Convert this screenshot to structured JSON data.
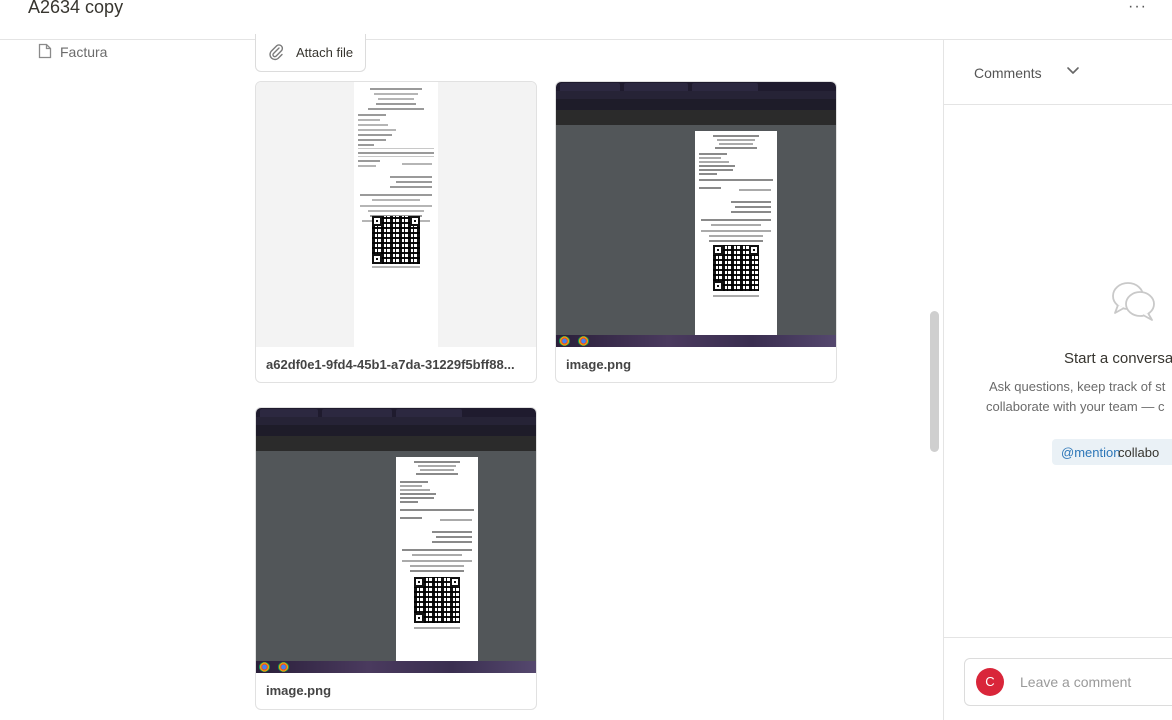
{
  "header": {
    "title": "A2634 copy",
    "more_icon": "ellipsis-icon",
    "more_label": "···"
  },
  "property": {
    "icon": "document-icon",
    "label": "Factura"
  },
  "attach": {
    "icon": "paperclip-icon",
    "label": "Attach file"
  },
  "attachments": [
    {
      "name": "a62df0e1-9fd4-45b1-a7da-31229f5bff88...",
      "kind": "receipt"
    },
    {
      "name": "image.png",
      "kind": "browser-screenshot"
    },
    {
      "name": "image.png",
      "kind": "browser-screenshot"
    }
  ],
  "comments": {
    "title": "Comments",
    "chevron_icon": "chevron-down-icon",
    "empty_icon": "chat-bubbles-icon",
    "empty_title": "Start a conversa",
    "empty_desc_line1": "Ask questions, keep track of st",
    "empty_desc_line2": "collaborate with your team — c",
    "mention": "@mention",
    "mention_rest": "collabo",
    "avatar_initial": "C",
    "composer_placeholder": "Leave a comment"
  },
  "colors": {
    "avatar": "#d9263a",
    "mention_bg": "#eaf1f6",
    "mention_text": "#2e77b8"
  }
}
